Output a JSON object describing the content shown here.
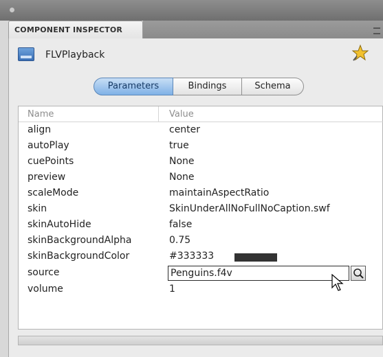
{
  "panel": {
    "tab_label": "COMPONENT INSPECTOR",
    "component_name": "FLVPlayback"
  },
  "tabs": [
    "Parameters",
    "Bindings",
    "Schema"
  ],
  "grid": {
    "columns": {
      "name": "Name",
      "value": "Value"
    },
    "rows": [
      {
        "name": "align",
        "value": "center"
      },
      {
        "name": "autoPlay",
        "value": "true"
      },
      {
        "name": "cuePoints",
        "value": "None"
      },
      {
        "name": "preview",
        "value": "None"
      },
      {
        "name": "scaleMode",
        "value": "maintainAspectRatio"
      },
      {
        "name": "skin",
        "value": "SkinUnderAllNoFullNoCaption.swf"
      },
      {
        "name": "skinAutoHide",
        "value": "false"
      },
      {
        "name": "skinBackgroundAlpha",
        "value": "0.75"
      },
      {
        "name": "skinBackgroundColor",
        "value": "#333333",
        "swatch_color": "#333333"
      },
      {
        "name": "source",
        "value": "Penguins.f4v"
      },
      {
        "name": "volume",
        "value": "1"
      }
    ]
  },
  "colors": {
    "selected_tab": "#7fb1e6",
    "titlebar": "#7f7f7f"
  },
  "icons": [
    "flvplayback-component-icon",
    "pin-icon",
    "magnifier-icon",
    "cursor-icon"
  ]
}
